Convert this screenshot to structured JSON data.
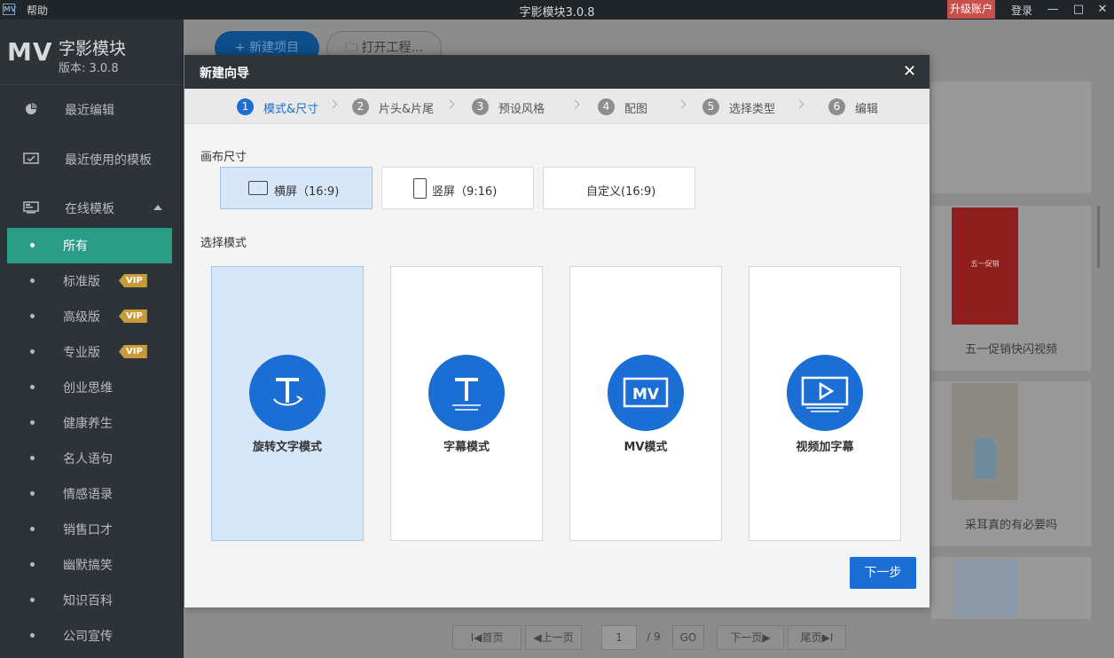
{
  "titlebar": {
    "logo": "MV",
    "help": "帮助",
    "title": "字影模块3.0.8",
    "upgrade": "升级账户",
    "login": "登录",
    "minimize": "—",
    "maximize": "□",
    "close": "✕"
  },
  "brand": {
    "logo": "MV",
    "name": "字影模块",
    "version": "版本: 3.0.8"
  },
  "sidebar": {
    "recent_edit": "最近编辑",
    "recent_templates": "最近使用的模板",
    "online_templates": "在线模板",
    "items": [
      {
        "label": "所有",
        "vip": ""
      },
      {
        "label": "标准版",
        "vip": "VIP"
      },
      {
        "label": "高级版",
        "vip": "VIP"
      },
      {
        "label": "专业版",
        "vip": "VIP"
      },
      {
        "label": "创业思维",
        "vip": ""
      },
      {
        "label": "健康养生",
        "vip": ""
      },
      {
        "label": "名人语句",
        "vip": ""
      },
      {
        "label": "情感语录",
        "vip": ""
      },
      {
        "label": "销售口才",
        "vip": ""
      },
      {
        "label": "幽默搞笑",
        "vip": ""
      },
      {
        "label": "知识百科",
        "vip": ""
      },
      {
        "label": "公司宣传",
        "vip": ""
      }
    ]
  },
  "main": {
    "new_project": "+ 新建项目",
    "open_project": "打开工程...",
    "cards": [
      {
        "caption": "五一促销快闪视频",
        "thumb_text": "五一促销"
      },
      {
        "caption": "采耳真的有必要吗"
      }
    ],
    "pager": {
      "first": "I◀首页",
      "prev": "◀上一页",
      "page": "1",
      "total": "/ 9",
      "go": "GO",
      "next": "下一页▶",
      "last": "尾页▶I"
    }
  },
  "modal": {
    "title": "新建向导",
    "close": "✕",
    "steps": [
      {
        "num": "1",
        "label": "模式&尺寸"
      },
      {
        "num": "2",
        "label": "片头&片尾"
      },
      {
        "num": "3",
        "label": "预设风格"
      },
      {
        "num": "4",
        "label": "配图"
      },
      {
        "num": "5",
        "label": "选择类型"
      },
      {
        "num": "6",
        "label": "编辑"
      }
    ],
    "canvas_size_label": "画布尺寸",
    "sizes": [
      {
        "label": "横屏（16:9)"
      },
      {
        "label": "竖屏（9:16)"
      },
      {
        "label": "自定义(16:9)"
      }
    ],
    "mode_label": "选择模式",
    "modes": [
      {
        "label": "旋转文字模式"
      },
      {
        "label": "字幕模式"
      },
      {
        "label": "MV模式",
        "icon_text": "MV"
      },
      {
        "label": "视频加字幕"
      }
    ],
    "next": "下一步"
  },
  "colors": {
    "accent": "#1a6ed4",
    "sidebar_active": "#2a9d86",
    "vip": "#c79a3a",
    "upgrade": "#c9504a"
  }
}
